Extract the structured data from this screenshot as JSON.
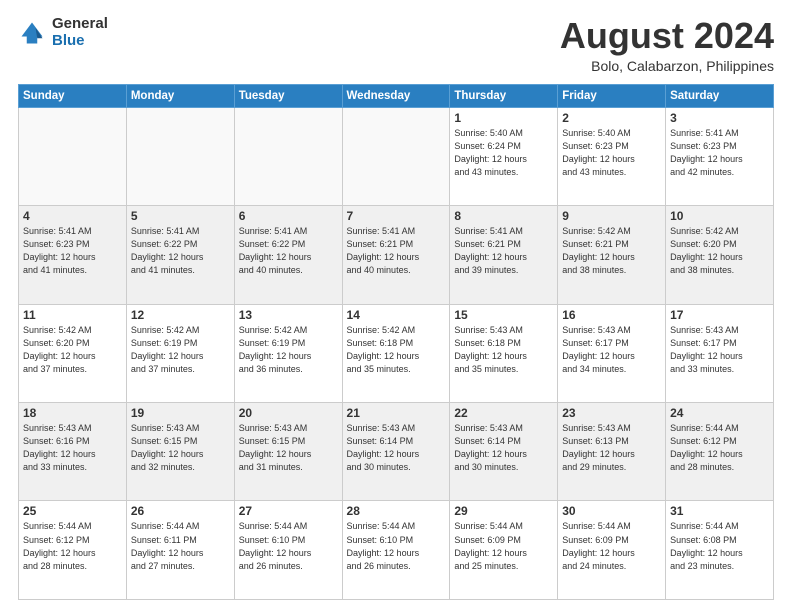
{
  "logo": {
    "general": "General",
    "blue": "Blue"
  },
  "title": "August 2024",
  "location": "Bolo, Calabarzon, Philippines",
  "days_header": [
    "Sunday",
    "Monday",
    "Tuesday",
    "Wednesday",
    "Thursday",
    "Friday",
    "Saturday"
  ],
  "weeks": [
    [
      {
        "num": "",
        "info": ""
      },
      {
        "num": "",
        "info": ""
      },
      {
        "num": "",
        "info": ""
      },
      {
        "num": "",
        "info": ""
      },
      {
        "num": "1",
        "info": "Sunrise: 5:40 AM\nSunset: 6:24 PM\nDaylight: 12 hours\nand 43 minutes."
      },
      {
        "num": "2",
        "info": "Sunrise: 5:40 AM\nSunset: 6:23 PM\nDaylight: 12 hours\nand 43 minutes."
      },
      {
        "num": "3",
        "info": "Sunrise: 5:41 AM\nSunset: 6:23 PM\nDaylight: 12 hours\nand 42 minutes."
      }
    ],
    [
      {
        "num": "4",
        "info": "Sunrise: 5:41 AM\nSunset: 6:23 PM\nDaylight: 12 hours\nand 41 minutes."
      },
      {
        "num": "5",
        "info": "Sunrise: 5:41 AM\nSunset: 6:22 PM\nDaylight: 12 hours\nand 41 minutes."
      },
      {
        "num": "6",
        "info": "Sunrise: 5:41 AM\nSunset: 6:22 PM\nDaylight: 12 hours\nand 40 minutes."
      },
      {
        "num": "7",
        "info": "Sunrise: 5:41 AM\nSunset: 6:21 PM\nDaylight: 12 hours\nand 40 minutes."
      },
      {
        "num": "8",
        "info": "Sunrise: 5:41 AM\nSunset: 6:21 PM\nDaylight: 12 hours\nand 39 minutes."
      },
      {
        "num": "9",
        "info": "Sunrise: 5:42 AM\nSunset: 6:21 PM\nDaylight: 12 hours\nand 38 minutes."
      },
      {
        "num": "10",
        "info": "Sunrise: 5:42 AM\nSunset: 6:20 PM\nDaylight: 12 hours\nand 38 minutes."
      }
    ],
    [
      {
        "num": "11",
        "info": "Sunrise: 5:42 AM\nSunset: 6:20 PM\nDaylight: 12 hours\nand 37 minutes."
      },
      {
        "num": "12",
        "info": "Sunrise: 5:42 AM\nSunset: 6:19 PM\nDaylight: 12 hours\nand 37 minutes."
      },
      {
        "num": "13",
        "info": "Sunrise: 5:42 AM\nSunset: 6:19 PM\nDaylight: 12 hours\nand 36 minutes."
      },
      {
        "num": "14",
        "info": "Sunrise: 5:42 AM\nSunset: 6:18 PM\nDaylight: 12 hours\nand 35 minutes."
      },
      {
        "num": "15",
        "info": "Sunrise: 5:43 AM\nSunset: 6:18 PM\nDaylight: 12 hours\nand 35 minutes."
      },
      {
        "num": "16",
        "info": "Sunrise: 5:43 AM\nSunset: 6:17 PM\nDaylight: 12 hours\nand 34 minutes."
      },
      {
        "num": "17",
        "info": "Sunrise: 5:43 AM\nSunset: 6:17 PM\nDaylight: 12 hours\nand 33 minutes."
      }
    ],
    [
      {
        "num": "18",
        "info": "Sunrise: 5:43 AM\nSunset: 6:16 PM\nDaylight: 12 hours\nand 33 minutes."
      },
      {
        "num": "19",
        "info": "Sunrise: 5:43 AM\nSunset: 6:15 PM\nDaylight: 12 hours\nand 32 minutes."
      },
      {
        "num": "20",
        "info": "Sunrise: 5:43 AM\nSunset: 6:15 PM\nDaylight: 12 hours\nand 31 minutes."
      },
      {
        "num": "21",
        "info": "Sunrise: 5:43 AM\nSunset: 6:14 PM\nDaylight: 12 hours\nand 30 minutes."
      },
      {
        "num": "22",
        "info": "Sunrise: 5:43 AM\nSunset: 6:14 PM\nDaylight: 12 hours\nand 30 minutes."
      },
      {
        "num": "23",
        "info": "Sunrise: 5:43 AM\nSunset: 6:13 PM\nDaylight: 12 hours\nand 29 minutes."
      },
      {
        "num": "24",
        "info": "Sunrise: 5:44 AM\nSunset: 6:12 PM\nDaylight: 12 hours\nand 28 minutes."
      }
    ],
    [
      {
        "num": "25",
        "info": "Sunrise: 5:44 AM\nSunset: 6:12 PM\nDaylight: 12 hours\nand 28 minutes."
      },
      {
        "num": "26",
        "info": "Sunrise: 5:44 AM\nSunset: 6:11 PM\nDaylight: 12 hours\nand 27 minutes."
      },
      {
        "num": "27",
        "info": "Sunrise: 5:44 AM\nSunset: 6:10 PM\nDaylight: 12 hours\nand 26 minutes."
      },
      {
        "num": "28",
        "info": "Sunrise: 5:44 AM\nSunset: 6:10 PM\nDaylight: 12 hours\nand 26 minutes."
      },
      {
        "num": "29",
        "info": "Sunrise: 5:44 AM\nSunset: 6:09 PM\nDaylight: 12 hours\nand 25 minutes."
      },
      {
        "num": "30",
        "info": "Sunrise: 5:44 AM\nSunset: 6:09 PM\nDaylight: 12 hours\nand 24 minutes."
      },
      {
        "num": "31",
        "info": "Sunrise: 5:44 AM\nSunset: 6:08 PM\nDaylight: 12 hours\nand 23 minutes."
      }
    ]
  ]
}
